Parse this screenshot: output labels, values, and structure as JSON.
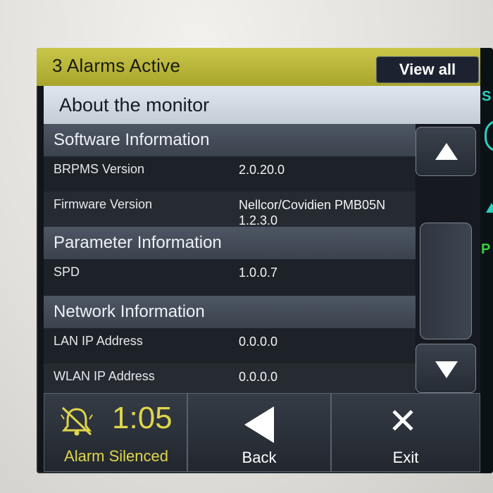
{
  "alarm_bar": {
    "text": "3 Alarms Active",
    "view_all_label": "View all"
  },
  "title": "About the monitor",
  "side_indicators": {
    "top_letter": "S",
    "mid_letter": "P"
  },
  "sections": [
    {
      "header": "Software Information",
      "rows": [
        {
          "label": "BRPMS Version",
          "value": "2.0.20.0"
        },
        {
          "label": "Firmware Version",
          "value": "Nellcor/Covidien PMB05N",
          "value_line2": "1.2.3.0"
        }
      ]
    },
    {
      "header": "Parameter Information",
      "rows": [
        {
          "label": "SPD",
          "value": "1.0.0.7"
        }
      ]
    },
    {
      "header": "Network Information",
      "rows": [
        {
          "label": "LAN IP Address",
          "value": "0.0.0.0"
        },
        {
          "label": "WLAN IP Address",
          "value": "0.0.0.0"
        }
      ]
    }
  ],
  "bottom": {
    "timer": "1:05",
    "silence_label": "Alarm Silenced",
    "back_label": "Back",
    "exit_label": "Exit"
  },
  "icons": [
    "bell-silenced-icon",
    "scroll-up-icon",
    "scroll-down-icon",
    "back-arrow-icon",
    "exit-x-icon"
  ],
  "colors": {
    "alarm_yellow": "#c9c64a",
    "silence_text": "#e0d64a",
    "accent_teal": "#2bd1c0",
    "accent_green": "#36d13f"
  }
}
